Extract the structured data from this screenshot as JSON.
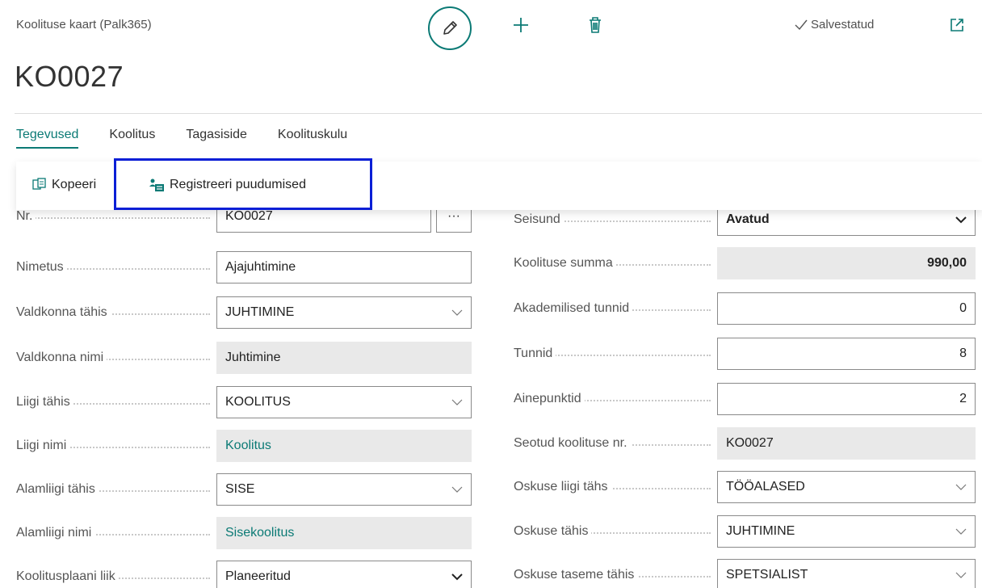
{
  "header": {
    "breadcrumb": "Koolituse kaart (Palk365)",
    "title": "KO0027",
    "saved_label": "Salvestatud"
  },
  "tabs": [
    {
      "label": "Tegevused"
    },
    {
      "label": "Koolitus"
    },
    {
      "label": "Tagasiside"
    },
    {
      "label": "Koolituskulu"
    }
  ],
  "actions": {
    "copy_label": "Kopeeri",
    "register_label": "Registreeri puudumised"
  },
  "left_fields": [
    {
      "label": "Nr.",
      "value": "KO0027"
    },
    {
      "label": "Nimetus",
      "value": "Ajajuhtimine"
    },
    {
      "label": "Valdkonna tähis",
      "value": "JUHTIMINE"
    },
    {
      "label": "Valdkonna nimi",
      "value": "Juhtimine"
    },
    {
      "label": "Liigi tähis",
      "value": "KOOLITUS"
    },
    {
      "label": "Liigi nimi",
      "value": "Koolitus"
    },
    {
      "label": "Alamliigi tähis",
      "value": "SISE"
    },
    {
      "label": "Alamliigi nimi",
      "value": "Sisekoolitus"
    },
    {
      "label": "Koolitusplaani liik",
      "value": "Planeeritud"
    }
  ],
  "right_fields": [
    {
      "label": "Seisund",
      "value": "Avatud"
    },
    {
      "label": "Koolituse summa",
      "value": "990,00"
    },
    {
      "label": "Akademilised tunnid",
      "value": "0"
    },
    {
      "label": "Tunnid",
      "value": "8"
    },
    {
      "label": "Ainepunktid",
      "value": "2"
    },
    {
      "label": "Seotud koolituse nr.",
      "value": "KO0027"
    },
    {
      "label": "Oskuse liigi tähs",
      "value": "TÖÖALASED"
    },
    {
      "label": "Oskuse tähis",
      "value": "JUHTIMINE"
    },
    {
      "label": "Oskuse taseme tähis",
      "value": "SPETSIALIST"
    }
  ],
  "lookup_label": "···",
  "colors": {
    "accent": "#0b7a75",
    "highlight": "#0a1fd6",
    "readonly_bg": "#e9e9e9"
  }
}
